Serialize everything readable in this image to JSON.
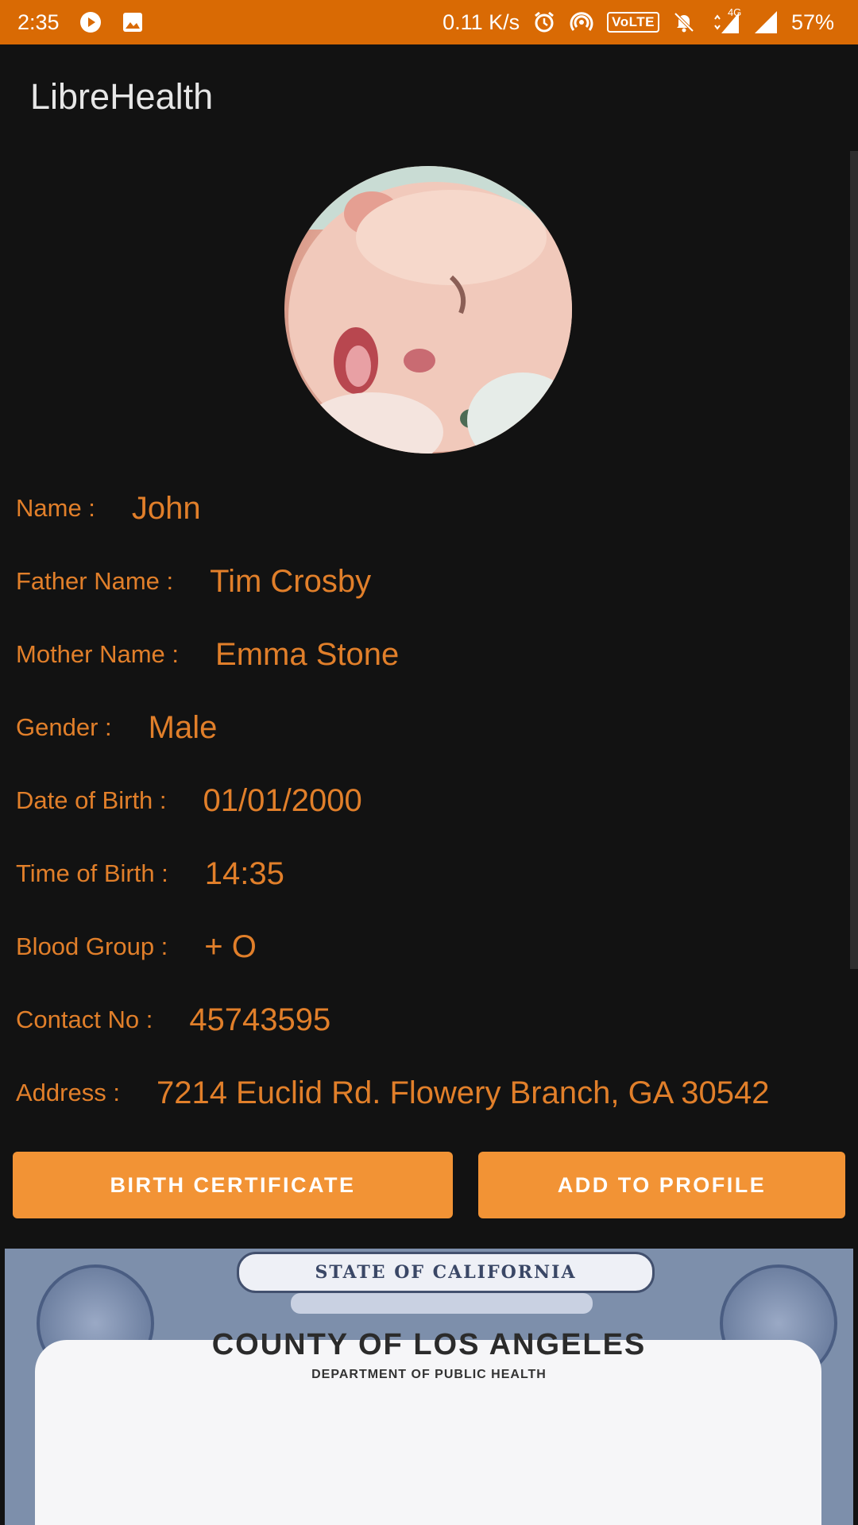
{
  "status_bar": {
    "time": "2:35",
    "net_speed": "0.11 K/s",
    "volte": "VoLTE",
    "network_badge": "4G",
    "battery": "57%",
    "icons": [
      "play-icon",
      "image-icon",
      "alarm-icon",
      "hotspot-icon",
      "mute-icon",
      "signal-icon",
      "battery-icon"
    ]
  },
  "app_bar": {
    "title": "LibreHealth"
  },
  "profile": {
    "name_label": "Name :",
    "name_value": "John",
    "father_label": "Father Name :",
    "father_value": "Tim Crosby",
    "mother_label": "Mother Name :",
    "mother_value": "Emma Stone",
    "gender_label": "Gender :",
    "gender_value": "Male",
    "dob_label": "Date of Birth :",
    "dob_value": "01/01/2000",
    "tob_label": "Time of Birth :",
    "tob_value": "14:35",
    "blood_label": "Blood Group :",
    "blood_value": "+ O",
    "contact_label": "Contact No :",
    "contact_value": "45743595",
    "address_label": "Address :",
    "address_value": "7214 Euclid Rd. Flowery Branch, GA 30542"
  },
  "buttons": {
    "birth_certificate": "BIRTH CERTIFICATE",
    "add_to_profile": "ADD TO PROFILE"
  },
  "certificate": {
    "banner": "STATE OF CALIFORNIA",
    "county": "COUNTY OF LOS ANGELES",
    "department": "DEPARTMENT OF PUBLIC HEALTH"
  },
  "colors": {
    "status_bar": "#d96a04",
    "background": "#121212",
    "accent_text": "#e17f2a",
    "button": "#f29335"
  }
}
